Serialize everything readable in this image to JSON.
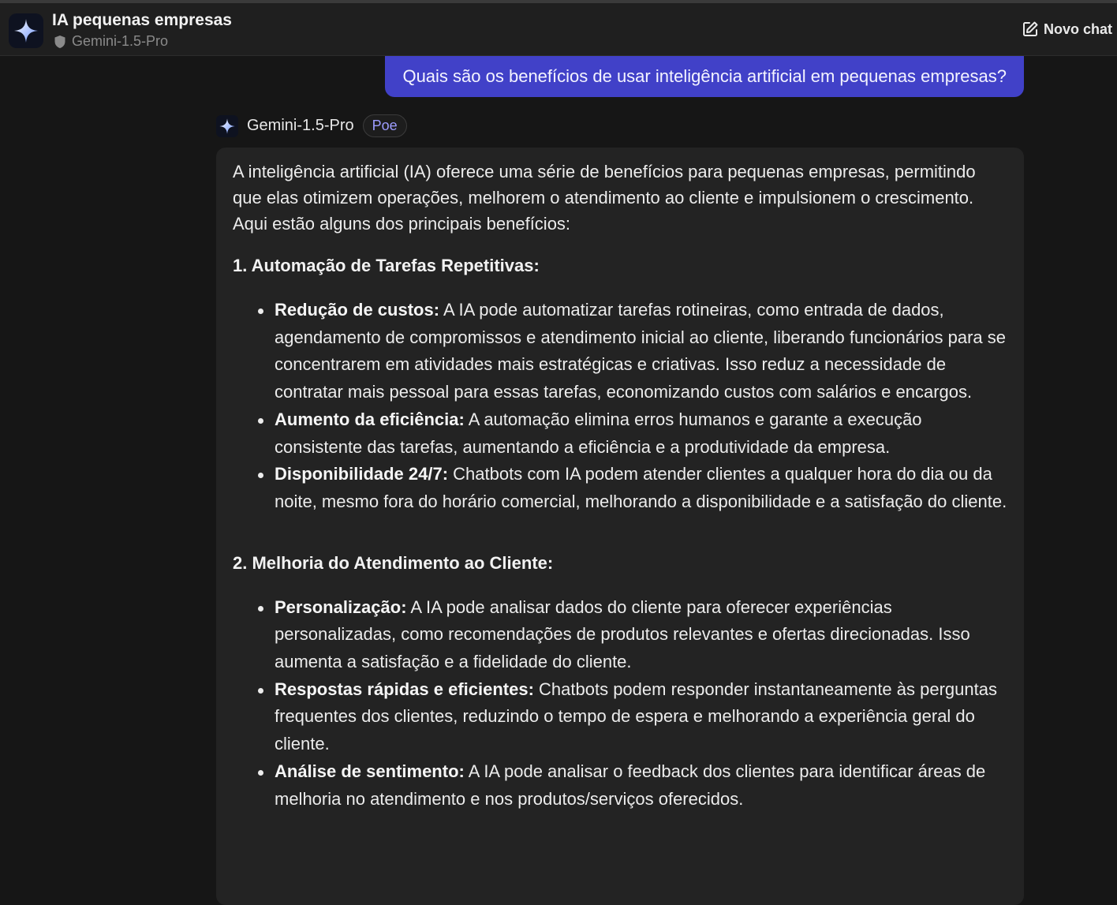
{
  "header": {
    "chat_title": "IA pequenas empresas",
    "bot_name": "Gemini-1.5-Pro",
    "new_chat_label": "Novo chat"
  },
  "user_message": "Quais são os benefícios de usar inteligência artificial em pequenas empresas?",
  "bot_message": {
    "bot_name": "Gemini-1.5-Pro",
    "badge": "Poe",
    "intro": "A inteligência artificial (IA) oferece uma série de benefícios para pequenas empresas, permitindo que elas otimizem operações, melhorem o atendimento ao cliente e impulsionem o crescimento. Aqui estão alguns dos principais benefícios:",
    "sections": [
      {
        "title": "1. Automação de Tarefas Repetitivas:",
        "items": [
          {
            "label": "Redução de custos:",
            "text": " A IA pode automatizar tarefas rotineiras, como entrada de dados, agendamento de compromissos e atendimento inicial ao cliente, liberando funcionários para se concentrarem em atividades mais estratégicas e criativas. Isso reduz a necessidade de contratar mais pessoal para essas tarefas, economizando custos com salários e encargos."
          },
          {
            "label": "Aumento da eficiência:",
            "text": " A automação elimina erros humanos e garante a execução consistente das tarefas, aumentando a eficiência e a produtividade da empresa."
          },
          {
            "label": "Disponibilidade 24/7:",
            "text": " Chatbots com IA podem atender clientes a qualquer hora do dia ou da noite, mesmo fora do horário comercial, melhorando a disponibilidade e a satisfação do cliente."
          }
        ]
      },
      {
        "title": "2. Melhoria do Atendimento ao Cliente:",
        "items": [
          {
            "label": "Personalização:",
            "text": " A IA pode analisar dados do cliente para oferecer experiências personalizadas, como recomendações de produtos relevantes e ofertas direcionadas. Isso aumenta a satisfação e a fidelidade do cliente."
          },
          {
            "label": "Respostas rápidas e eficientes:",
            "text": " Chatbots podem responder instantaneamente às perguntas frequentes dos clientes, reduzindo o tempo de espera e melhorando a experiência geral do cliente."
          },
          {
            "label": "Análise de sentimento:",
            "text": " A IA pode analisar o feedback dos clientes para identificar áreas de melhoria no atendimento e nos produtos/serviços oferecidos."
          }
        ]
      }
    ]
  },
  "icons": {
    "bot_avatar": "gemini-sparkle-icon",
    "verified": "shield-icon",
    "new_chat": "edit-square-icon"
  },
  "colors": {
    "user_bubble": "#4141c8",
    "badge_text": "#9d9dff",
    "sparkle": "#7aa8ff"
  }
}
